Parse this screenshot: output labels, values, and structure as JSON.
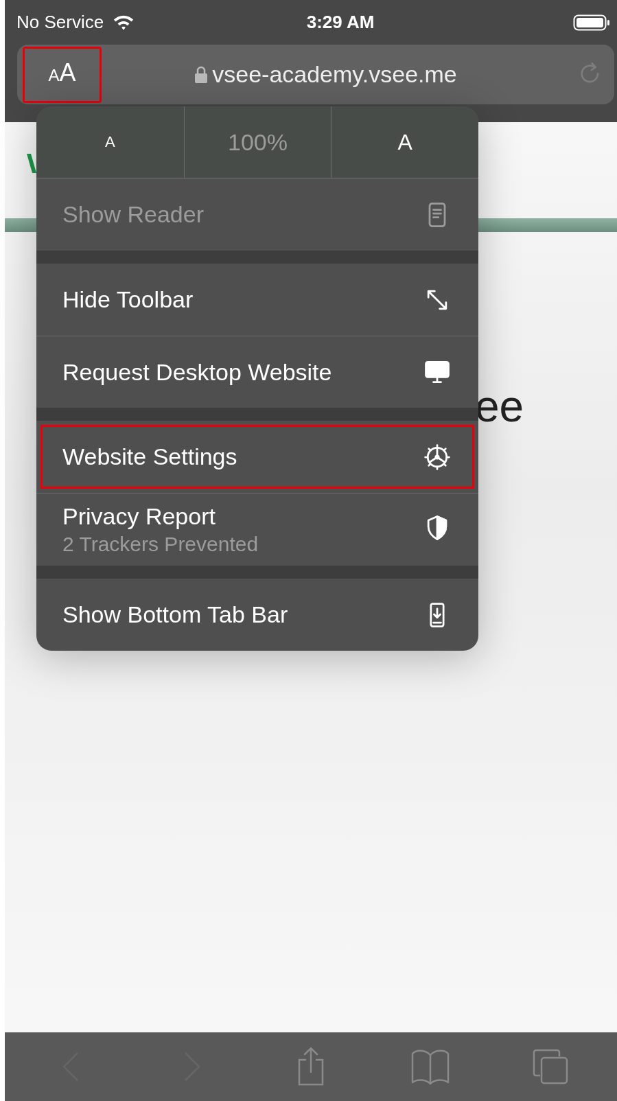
{
  "status_bar": {
    "carrier": "No Service",
    "time": "3:29 AM"
  },
  "address_bar": {
    "text_size_button": {
      "small": "A",
      "large": "A",
      "highlighted": true
    },
    "url": "vsee-academy.vsee.me"
  },
  "page": {
    "heading_fragment": "ee"
  },
  "menu": {
    "text_size": {
      "decrease": "A",
      "zoom": "100%",
      "increase": "A"
    },
    "sections": [
      {
        "items": [
          {
            "label": "Show Reader",
            "disabled": true,
            "highlighted": false
          }
        ]
      },
      {
        "items": [
          {
            "label": "Hide Toolbar",
            "disabled": false,
            "highlighted": false
          },
          {
            "label": "Request Desktop Website",
            "disabled": false,
            "highlighted": false
          }
        ]
      },
      {
        "items": [
          {
            "label": "Website Settings",
            "disabled": false,
            "highlighted": true
          },
          {
            "label": "Privacy Report",
            "sublabel": "2 Trackers Prevented",
            "disabled": false,
            "highlighted": false
          }
        ]
      },
      {
        "items": [
          {
            "label": "Show Bottom Tab Bar",
            "disabled": false,
            "highlighted": false
          }
        ]
      }
    ]
  },
  "toolbar": {
    "back_disabled": true,
    "forward_disabled": true
  }
}
